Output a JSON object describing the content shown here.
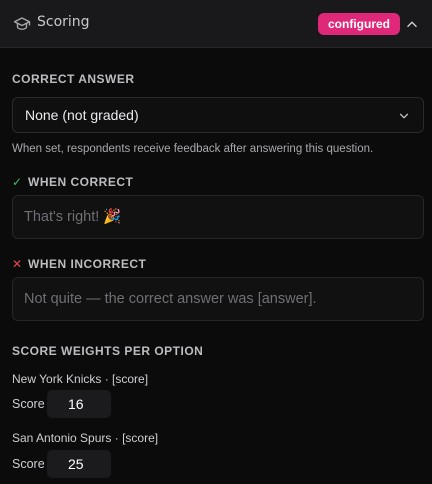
{
  "header": {
    "title": "Scoring",
    "icon": "graduation-cap-icon",
    "badge": "configured",
    "badge_color": "#e0287a"
  },
  "correct_answer": {
    "label": "CORRECT ANSWER",
    "selected": "None (not graded)",
    "help": "When set, respondents receive feedback after answering this question."
  },
  "when_correct": {
    "mark": "✓",
    "mark_color": "#3fbf63",
    "label": "WHEN CORRECT",
    "placeholder": "That's right! 🎉",
    "value": ""
  },
  "when_incorrect": {
    "mark": "✕",
    "mark_color": "#e5484d",
    "label": "WHEN INCORRECT",
    "placeholder": "Not quite — the correct answer was [answer].",
    "value": ""
  },
  "score_weights": {
    "label": "SCORE WEIGHTS PER OPTION",
    "options": [
      {
        "name": "New York Knicks · [score]",
        "score_label": "Score",
        "score": "16"
      },
      {
        "name": "San Antonio Spurs · [score]",
        "score_label": "Score",
        "score": "25"
      }
    ]
  }
}
